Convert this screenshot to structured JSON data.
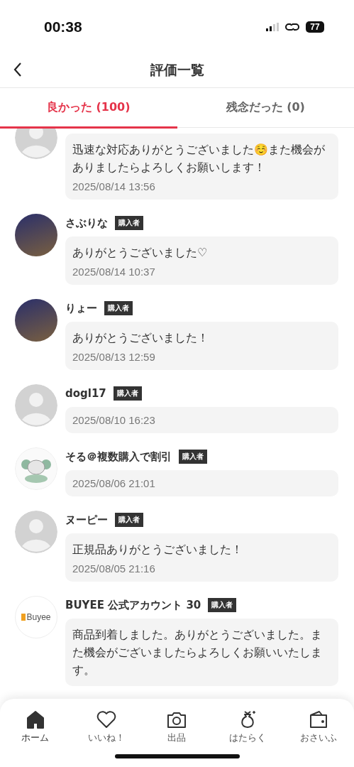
{
  "status_bar": {
    "time": "00:38",
    "battery": "77"
  },
  "header": {
    "title": "評価一覧"
  },
  "tabs": [
    {
      "label": "良かった (100)",
      "selected": true
    },
    {
      "label": "残念だった (0)",
      "selected": false
    }
  ],
  "reviews": [
    {
      "kind": "silhouette",
      "comment": "迅速な対応ありがとうございました☺️また機会がありましたらよろしくお願いします！",
      "date": "2025/08/14 13:56"
    },
    {
      "kind": "photo",
      "name": "さぶりな",
      "badge": "購入者",
      "comment": "ありがとうございました♡",
      "date": "2025/08/14 10:37"
    },
    {
      "kind": "photo",
      "name": "りょー",
      "badge": "購入者",
      "comment": "ありがとうございました！",
      "date": "2025/08/13 12:59"
    },
    {
      "kind": "silhouette",
      "name": "dogl17",
      "badge": "購入者",
      "date": "2025/08/10 16:23"
    },
    {
      "kind": "illustration",
      "name": "そる＠複数購入で割引",
      "badge": "購入者",
      "date": "2025/08/06 21:01"
    },
    {
      "kind": "silhouette",
      "name": "ヌーピー",
      "badge": "購入者",
      "comment": "正規品ありがとうございました！",
      "date": "2025/08/05 21:16"
    },
    {
      "kind": "logo",
      "logo_text": "Buyee",
      "name": "BUYEE 公式アカウント 30",
      "badge": "購入者",
      "comment": "商品到着しました。ありがとうございました。また機会がございましたらよろしくお願いいたします。"
    }
  ],
  "bottom_nav": [
    {
      "label": "ホーム",
      "selected": true
    },
    {
      "label": "いいね！",
      "selected": false
    },
    {
      "label": "出品",
      "selected": false
    },
    {
      "label": "はたらく",
      "selected": false
    },
    {
      "label": "おさいふ",
      "selected": false
    }
  ]
}
